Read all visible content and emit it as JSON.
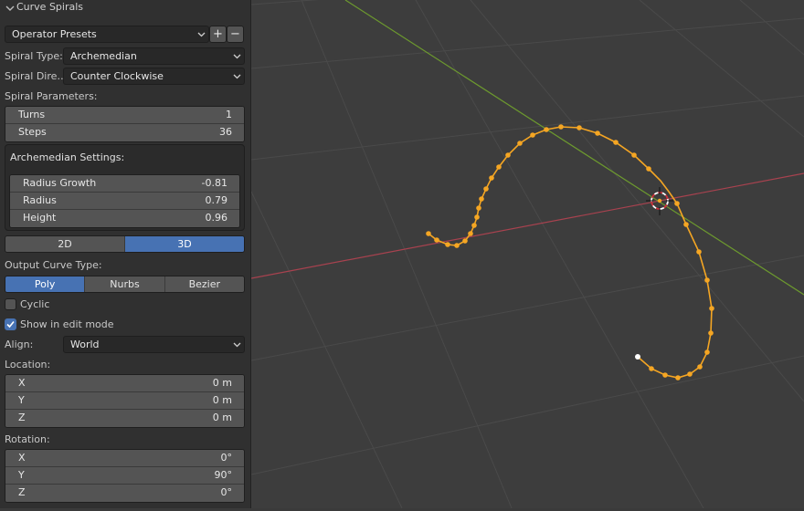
{
  "panel": {
    "title": "Curve Spirals",
    "presets": {
      "label": "Operator Presets",
      "add": "+",
      "remove": "−"
    },
    "spiral_type": {
      "label": "Spiral Type:",
      "value": "Archemedian"
    },
    "spiral_direction": {
      "label": "Spiral Dire…",
      "value": "Counter Clockwise"
    },
    "spiral_params": {
      "heading": "Spiral Parameters:",
      "rows": [
        {
          "label": "Turns",
          "value": "1"
        },
        {
          "label": "Steps",
          "value": "36"
        }
      ]
    },
    "arch_settings": {
      "heading": "Archemedian Settings:",
      "rows": [
        {
          "label": "Radius Growth",
          "value": "-0.81"
        },
        {
          "label": "Radius",
          "value": "0.79"
        },
        {
          "label": "Height",
          "value": "0.96"
        }
      ]
    },
    "dimension": {
      "options": [
        "2D",
        "3D"
      ],
      "selected": "3D"
    },
    "output_type": {
      "label": "Output Curve Type:",
      "options": [
        "Poly",
        "Nurbs",
        "Bezier"
      ],
      "selected": "Poly"
    },
    "cyclic": {
      "label": "Cyclic",
      "checked": false
    },
    "show_edit": {
      "label": "Show in edit mode",
      "checked": true
    },
    "align": {
      "label": "Align:",
      "value": "World"
    },
    "location": {
      "heading": "Location:",
      "rows": [
        {
          "label": "X",
          "value": "0 m"
        },
        {
          "label": "Y",
          "value": "0 m"
        },
        {
          "label": "Z",
          "value": "0 m"
        }
      ]
    },
    "rotation": {
      "heading": "Rotation:",
      "rows": [
        {
          "label": "X",
          "value": "0°"
        },
        {
          "label": "Y",
          "value": "90°"
        },
        {
          "label": "Z",
          "value": "0°"
        }
      ]
    }
  },
  "colors": {
    "accent": "#4772b3",
    "curve": "#f5a623",
    "x_axis": "#a8424f",
    "y_axis": "#6d9a2e"
  }
}
